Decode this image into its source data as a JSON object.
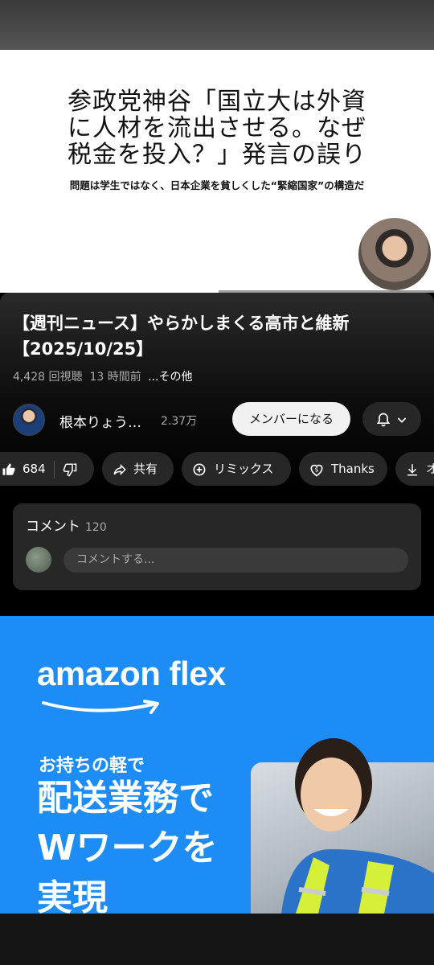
{
  "video": {
    "slide_title_lines": [
      "参政党神谷「国立大は外資",
      "に人材を流出させる。なぜ",
      "税金を投入？」発言の誤り"
    ],
    "slide_subtitle": "問題は学生ではなく、日本企業を貧しくした“緊縮国家”の構造だ"
  },
  "info": {
    "title_line1": "【週刊ニュース】やらかしまくる高市と維新",
    "title_line2": "【2025/10/25】",
    "views": "4,428 回視聴",
    "time": "13 時間前",
    "more": "...その他",
    "channel_name": "根本りょう…",
    "subscribers": "2.37万",
    "member_button": "メンバーになる",
    "bell_icon": "bell-icon",
    "chevron_icon": "chevron-down-icon"
  },
  "actions": {
    "like_count": "684",
    "share_label": "共有",
    "remix_label": "リミックス",
    "thanks_label": "Thanks",
    "download_label": "オフ"
  },
  "comments": {
    "header": "コメント",
    "count": "120",
    "placeholder": "コメントする..."
  },
  "ad": {
    "brand": "amazon flex",
    "line1": "お持ちの軽で",
    "line2": "配送業務で",
    "line3": "Wワークを",
    "line4": "実現",
    "background_color": "#1e8cf5"
  }
}
